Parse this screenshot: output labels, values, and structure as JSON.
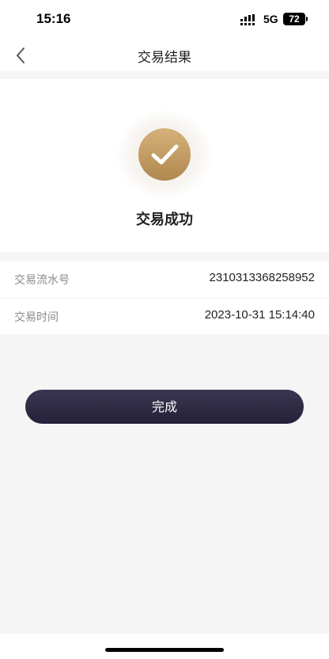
{
  "status_bar": {
    "time": "15:16",
    "network": "5G",
    "battery": "72",
    "icons": [
      "signal-icon",
      "battery-icon"
    ]
  },
  "nav": {
    "title": "交易结果",
    "back_icon": "chevron-left-icon"
  },
  "result": {
    "status_icon": "check-circle-icon",
    "message": "交易成功",
    "accent_color": "#c19a62"
  },
  "details": [
    {
      "label": "交易流水号",
      "value": "2310313368258952"
    },
    {
      "label": "交易时间",
      "value": "2023-10-31 15:14:40"
    }
  ],
  "actions": {
    "done_label": "完成",
    "done_color": "#2a2740"
  }
}
